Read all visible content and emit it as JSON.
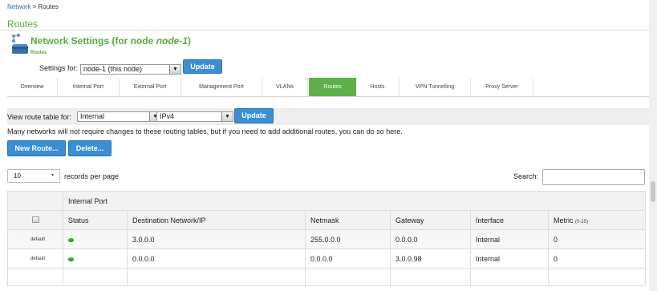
{
  "breadcrumb": {
    "root": "Network",
    "separator": " > ",
    "current": "Routes"
  },
  "page_title": "Routes",
  "heading": {
    "prefix": "Network Settings (for node ",
    "node": "node-1",
    "suffix": ")"
  },
  "sub_heading": "Routes",
  "settings_for": {
    "label": "Settings for:",
    "value": "node-1 (this node)",
    "update_label": "Update"
  },
  "tabs": [
    {
      "label": "Overview",
      "active": false
    },
    {
      "label": "Internal Port",
      "active": false
    },
    {
      "label": "External Port",
      "active": false
    },
    {
      "label": "Management Port",
      "active": false
    },
    {
      "label": "VLANs",
      "active": false
    },
    {
      "label": "Routes",
      "active": true
    },
    {
      "label": "Hosts",
      "active": false
    },
    {
      "label": "VPN Tunnelling",
      "active": false
    },
    {
      "label": "Proxy Server",
      "active": false
    }
  ],
  "view_route": {
    "label": "View route table for:",
    "interface": "Internal",
    "ip_version": "IPv4",
    "update_label": "Update"
  },
  "info_text": "Many networks will not require changes to these routing tables, but if you need to add additional routes, you can do so here.",
  "actions": {
    "new_route": "New Route...",
    "delete": "Delete..."
  },
  "pagination": {
    "page_size": "10",
    "records_label": "records per page"
  },
  "search": {
    "label": "Search:",
    "value": ""
  },
  "table": {
    "group_label": "Internal Port",
    "columns": [
      "Status",
      "Destination Network/IP",
      "Netmask",
      "Gateway",
      "Interface",
      "Metric"
    ],
    "metric_range": "(0-15)",
    "rows": [
      {
        "label": "default",
        "destination": "3.0.0.0",
        "netmask": "255.0.0.0",
        "gateway": "0.0.0.0",
        "interface": "Internal",
        "metric": "0"
      },
      {
        "label": "default",
        "destination": "0.0.0.0",
        "netmask": "0.0.0.0",
        "gateway": "3.0.0.98",
        "interface": "Internal",
        "metric": "0"
      }
    ]
  },
  "colors": {
    "brand_green": "#5aa843",
    "active_tab": "#5fb04a",
    "button_blue": "#3a8ed4",
    "status_green": "#3bb23b"
  }
}
